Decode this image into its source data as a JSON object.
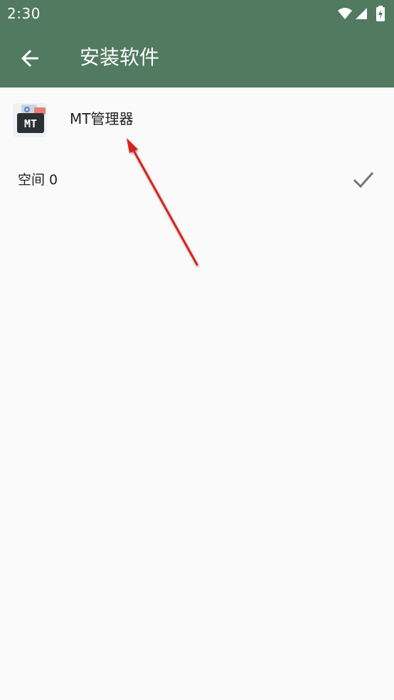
{
  "status_bar": {
    "time": "2:30",
    "icons": [
      "wifi-icon",
      "signal-icon",
      "battery-charging-icon"
    ]
  },
  "app_bar": {
    "back_icon": "arrow-left-icon",
    "title": "安装软件"
  },
  "app": {
    "icon": "mt-manager-app-icon",
    "icon_text": "MT",
    "name": "MT管理器"
  },
  "space_list": [
    {
      "label": "空间 0",
      "selected": true,
      "check_icon": "checkmark-icon"
    }
  ],
  "colors": {
    "primary": "#517A60",
    "background": "#FAFAFA",
    "text": "#1F1F1F",
    "check": "#757575",
    "annotation_arrow": "#D8211F"
  }
}
